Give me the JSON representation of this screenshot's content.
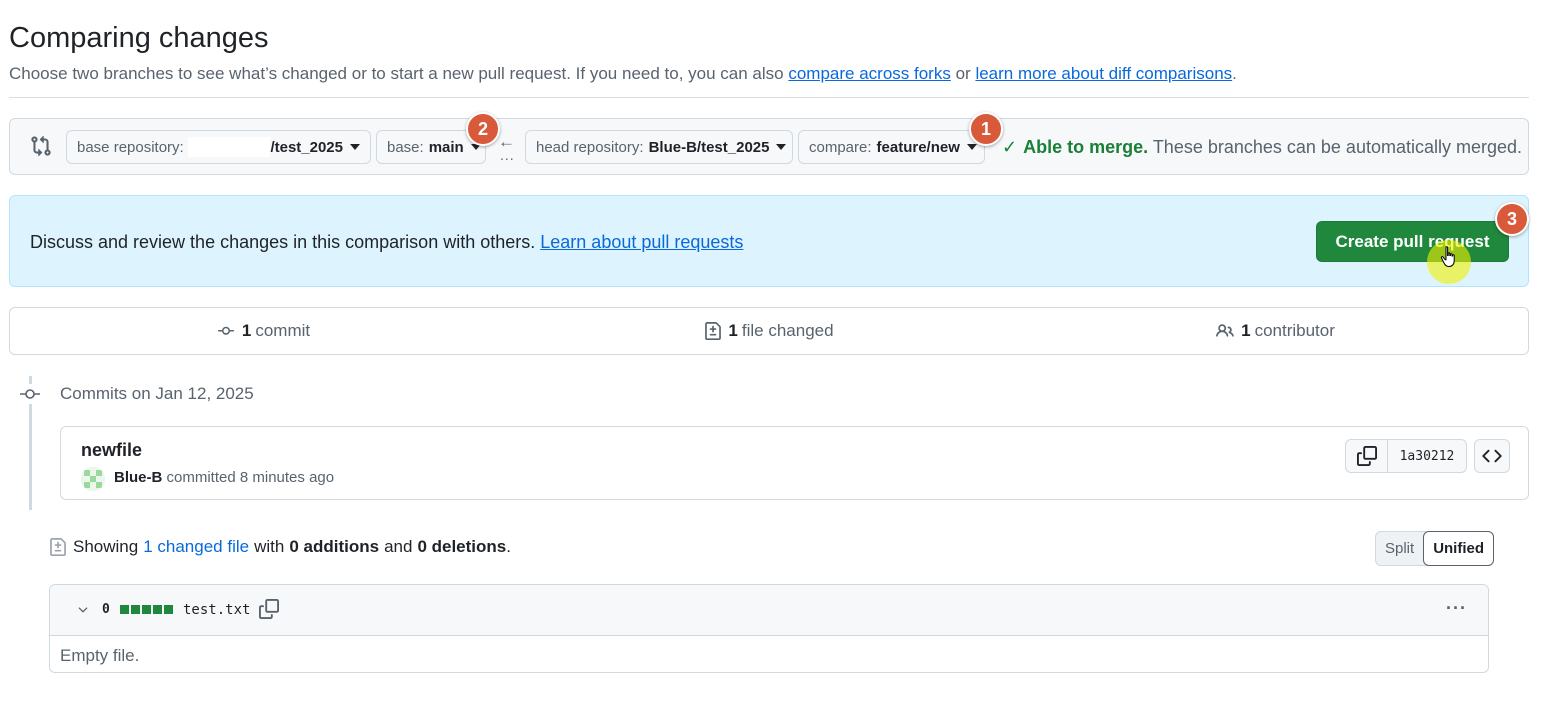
{
  "page": {
    "title": "Comparing changes",
    "subtitle_text": "Choose two branches to see what’s changed or to start a new pull request. If you need to, you can also",
    "link_compare_forks": "compare across forks",
    "subtitle_or": "or",
    "link_learn_diff": "learn more about diff comparisons",
    "subtitle_end": "."
  },
  "range": {
    "base_repo_label": "base repository:",
    "base_repo_value": "/test_2025",
    "base_label": "base:",
    "base_value": "main",
    "arrow": "←",
    "dots": "...",
    "head_repo_label": "head repository:",
    "head_repo_value": "Blue-B/test_2025",
    "compare_label": "compare:",
    "compare_value": "feature/new",
    "merge_status": "Able to merge.",
    "merge_note": "These branches can be automatically merged."
  },
  "badges": {
    "b1": "1",
    "b2": "2",
    "b3": "3"
  },
  "blankslate": {
    "text": "Discuss and review the changes in this comparison with others.",
    "link": "Learn about pull requests",
    "create_button": "Create pull request"
  },
  "summary": {
    "commits_count": "1",
    "commits_label": "commit",
    "files_count": "1",
    "files_label": "file changed",
    "contributors_count": "1",
    "contributors_label": "contributor"
  },
  "commits": {
    "date_heading": "Commits on Jan 12, 2025",
    "item": {
      "title": "newfile",
      "author": "Blue-B",
      "meta": "committed 8 minutes ago",
      "sha": "1a30212"
    }
  },
  "diff": {
    "showing": "Showing",
    "changed_files_link": "1 changed file",
    "with": "with",
    "additions": "0 additions",
    "and": "and",
    "deletions": "0 deletions",
    "period": ".",
    "view_split": "Split",
    "view_unified": "Unified",
    "file": {
      "count": "0",
      "name": "test.txt",
      "more": "···",
      "body": "Empty file."
    }
  },
  "colors": {
    "primary_button": "#1f883d",
    "link": "#0969da",
    "success": "#1a7f37",
    "badge": "#d95a3b",
    "info_bg": "#ddf4ff"
  }
}
